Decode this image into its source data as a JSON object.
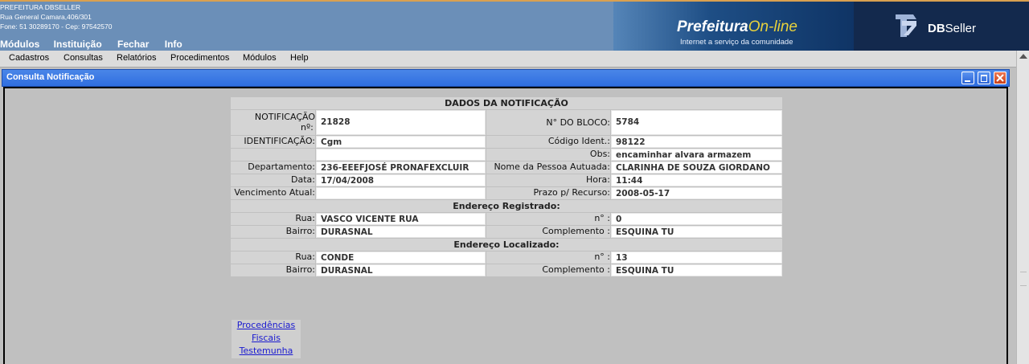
{
  "header": {
    "org_name": "PREFEITURA DBSELLER",
    "address": "Rua General Camara,406/301",
    "contact": "Fone: 51 30289170  -  Cep: 97542570",
    "main_menu": [
      "Módulos",
      "Instituição",
      "Fechar",
      "Info"
    ],
    "logo_title_main": "Prefeitura",
    "logo_title_accent": "On-line",
    "logo_subtitle": "Internet a serviço da comunidade",
    "brand_bold": "DB",
    "brand_light": "Seller"
  },
  "menubar": [
    "Cadastros",
    "Consultas",
    "Relatórios",
    "Procedimentos",
    "Módulos",
    "Help"
  ],
  "window": {
    "title": "Consulta Notificação"
  },
  "form": {
    "section_title": "DADOS DA NOTIFICAÇÃO",
    "notificacao_label_1": "NOTIFICAÇÃO",
    "notificacao_label_2": "nº:",
    "notificacao_value": "21828",
    "bloco_label": "N° DO BLOCO:",
    "bloco_value": "5784",
    "identificacao_label": "IDENTIFICAÇÃO:",
    "identificacao_value": "Cgm",
    "codigo_label": "Código Ident.:",
    "codigo_value": "98122",
    "blank_value": "",
    "obs_label": "Obs:",
    "obs_value": "encaminhar alvara armazem",
    "departamento_label": "Departamento:",
    "departamento_value": "236-EEEFJOSÉ PRONAFEXCLUIR",
    "pessoa_label": "Nome da Pessoa Autuada:",
    "pessoa_value": "CLARINHA DE SOUZA GIORDANO",
    "data_label": "Data:",
    "data_value": "17/04/2008",
    "hora_label": "Hora:",
    "hora_value": "11:44",
    "vencimento_label": "Vencimento Atual:",
    "vencimento_value": "",
    "prazo_label": "Prazo p/ Recurso:",
    "prazo_value": "2008-05-17",
    "end_registrado_title": "Endereço Registrado:",
    "reg_rua_label": "Rua:",
    "reg_rua_value": "VASCO VICENTE RUA",
    "reg_num_label": "n° :",
    "reg_num_value": "0",
    "reg_bairro_label": "Bairro:",
    "reg_bairro_value": "DURASNAL",
    "reg_compl_label": "Complemento :",
    "reg_compl_value": "ESQUINA TU",
    "end_localizado_title": "Endereço Localizado:",
    "loc_rua_label": "Rua:",
    "loc_rua_value": "CONDE",
    "loc_num_label": "n° :",
    "loc_num_value": "13",
    "loc_bairro_label": "Bairro:",
    "loc_bairro_value": "DURASNAL",
    "loc_compl_label": "Complemento :",
    "loc_compl_value": "ESQUINA TU"
  },
  "links": [
    "Procedências",
    "Fiscais",
    "Testemunha"
  ]
}
